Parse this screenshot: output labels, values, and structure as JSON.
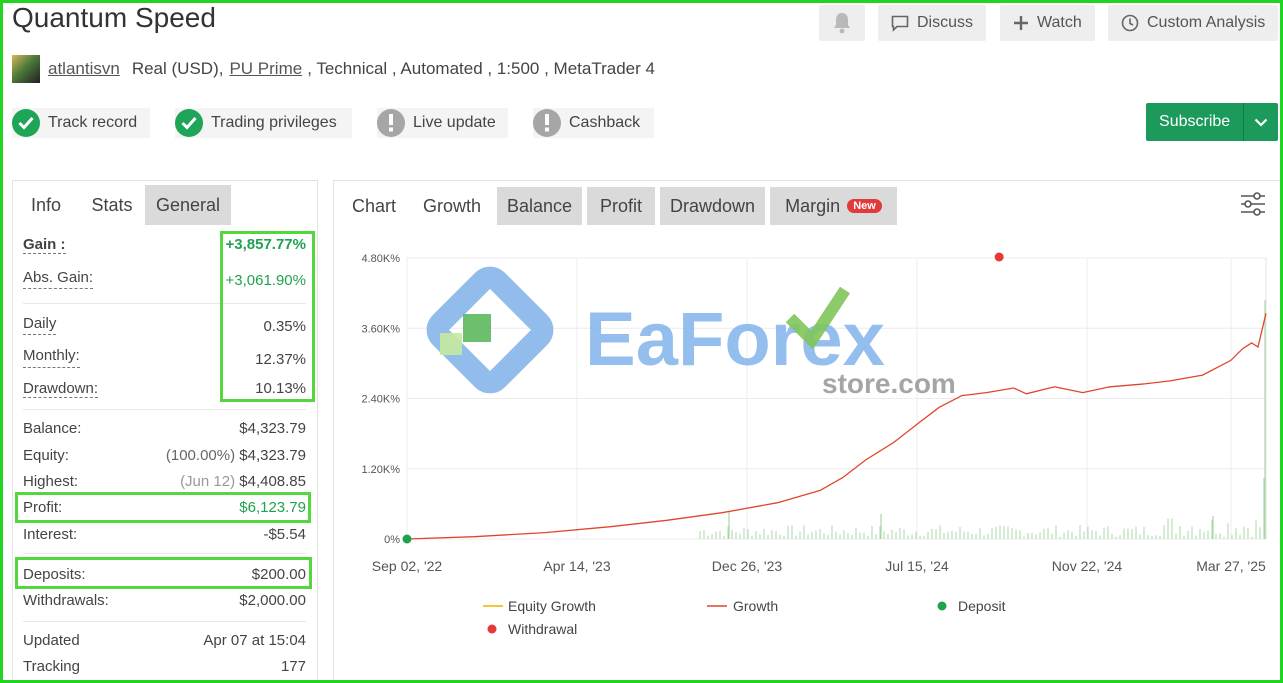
{
  "page": {
    "title": "Quantum Speed"
  },
  "header_actions": {
    "discuss": "Discuss",
    "watch": "Watch",
    "custom_analysis": "Custom Analysis"
  },
  "account": {
    "username": "atlantisvn",
    "type": "Real (USD),",
    "broker": "PU Prime",
    "rest": ", Technical , Automated , 1:500 , MetaTrader 4"
  },
  "badges": {
    "track_record": "Track record",
    "trading_privileges": "Trading privileges",
    "live_update": "Live update",
    "cashback": "Cashback"
  },
  "subscribe": {
    "label": "Subscribe"
  },
  "left_tabs": {
    "info": "Info",
    "stats": "Stats",
    "general": "General"
  },
  "stats": {
    "gain_label": "Gain :",
    "gain_value": "+3,857.77%",
    "abs_gain_label": "Abs. Gain:",
    "abs_gain_value": "+3,061.90%",
    "daily_label": "Daily",
    "daily_value": "0.35%",
    "monthly_label": "Monthly:",
    "monthly_value": "12.37%",
    "drawdown_label": "Drawdown:",
    "drawdown_value": "10.13%",
    "balance_label": "Balance:",
    "balance_value": "$4,323.79",
    "equity_label": "Equity:",
    "equity_pct": "(100.00%)",
    "equity_value": "$4,323.79",
    "highest_label": "Highest:",
    "highest_date": "(Jun 12)",
    "highest_value": "$4,408.85",
    "profit_label": "Profit:",
    "profit_value": "$6,123.79",
    "interest_label": "Interest:",
    "interest_value": "-$5.54",
    "deposits_label": "Deposits:",
    "deposits_value": "$200.00",
    "withdrawals_label": "Withdrawals:",
    "withdrawals_value": "$2,000.00",
    "updated_label": "Updated",
    "updated_value": "Apr 07 at 15:04",
    "tracking_label": "Tracking",
    "tracking_value": "177"
  },
  "chart_tabs": {
    "chart": "Chart",
    "growth": "Growth",
    "balance": "Balance",
    "profit": "Profit",
    "drawdown": "Drawdown",
    "margin": "Margin",
    "margin_badge": "New"
  },
  "watermark": {
    "main": "EaForex",
    "sub": "store.com"
  },
  "colors": {
    "accent_green": "#1b9a5c",
    "growth_line": "#e0452b",
    "equity_line": "#f0b400",
    "deposit": "#1fa24f",
    "withdrawal": "#e53935",
    "highlight": "#53d63e"
  },
  "chart_data": {
    "type": "line",
    "x_ticks": [
      "Sep 02, '22",
      "Apr 14, '23",
      "Dec 26, '23",
      "Jul 15, '24",
      "Nov 22, '24",
      "Mar 27, '25"
    ],
    "y_ticks": [
      "0%",
      "1.20K%",
      "2.40K%",
      "3.60K%",
      "4.80K%"
    ],
    "ylim": [
      0,
      4800
    ],
    "grid": true,
    "legend_position": "bottom",
    "series": [
      {
        "name": "Equity Growth",
        "values": []
      },
      {
        "name": "Growth",
        "x": [
          "2022-09-02",
          "2022-11-15",
          "2023-02-01",
          "2023-04-14",
          "2023-06-15",
          "2023-08-15",
          "2023-10-15",
          "2023-12-01",
          "2023-12-26",
          "2024-01-20",
          "2024-02-20",
          "2024-03-20",
          "2024-04-10",
          "2024-05-05",
          "2024-06-01",
          "2024-07-01",
          "2024-07-15",
          "2024-08-15",
          "2024-09-15",
          "2024-10-15",
          "2024-11-22",
          "2024-12-20",
          "2025-01-25",
          "2025-02-25",
          "2025-03-10",
          "2025-03-20",
          "2025-03-27",
          "2025-04-07"
        ],
        "values": [
          0,
          40,
          110,
          210,
          320,
          450,
          620,
          830,
          1050,
          1350,
          1650,
          2000,
          2250,
          2450,
          2500,
          2580,
          2480,
          2600,
          2500,
          2600,
          2650,
          2700,
          2800,
          3050,
          3250,
          3350,
          3280,
          3857
        ]
      }
    ],
    "markers": [
      {
        "name": "Deposit",
        "x": "2022-09-02",
        "y": 0
      },
      {
        "name": "Withdrawal",
        "x": "2024-06-15",
        "y": 4800
      }
    ]
  },
  "chart_legend": {
    "equity": "Equity Growth",
    "growth": "Growth",
    "deposit": "Deposit",
    "withdrawal": "Withdrawal"
  }
}
